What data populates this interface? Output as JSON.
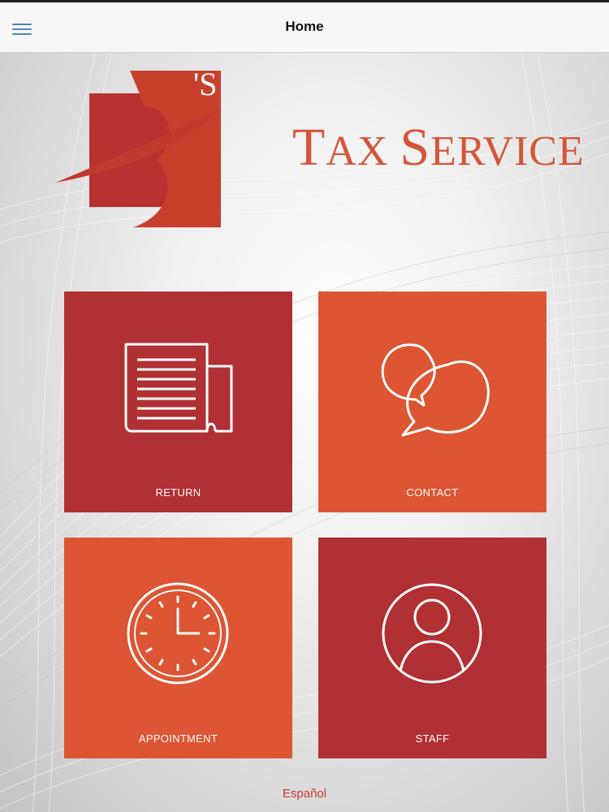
{
  "header": {
    "title": "Home",
    "menu_icon": "hamburger-menu-icon"
  },
  "logo": {
    "brand_mark": "B's",
    "text": "Tax Service",
    "text_big_1": "T",
    "text_small_1": "AX ",
    "text_big_2": "S",
    "text_small_2": "ERVICE",
    "color": "#d4553a"
  },
  "tiles": [
    {
      "label": "RETURN",
      "icon": "newspaper-icon",
      "color": "#b13033"
    },
    {
      "label": "CONTACT",
      "icon": "chat-bubbles-icon",
      "color": "#dd5533"
    },
    {
      "label": "APPOINTMENT",
      "icon": "clock-icon",
      "color": "#dd5533"
    },
    {
      "label": "STAFF",
      "icon": "person-icon",
      "color": "#b13033"
    }
  ],
  "footer": {
    "language_link": "Español"
  }
}
